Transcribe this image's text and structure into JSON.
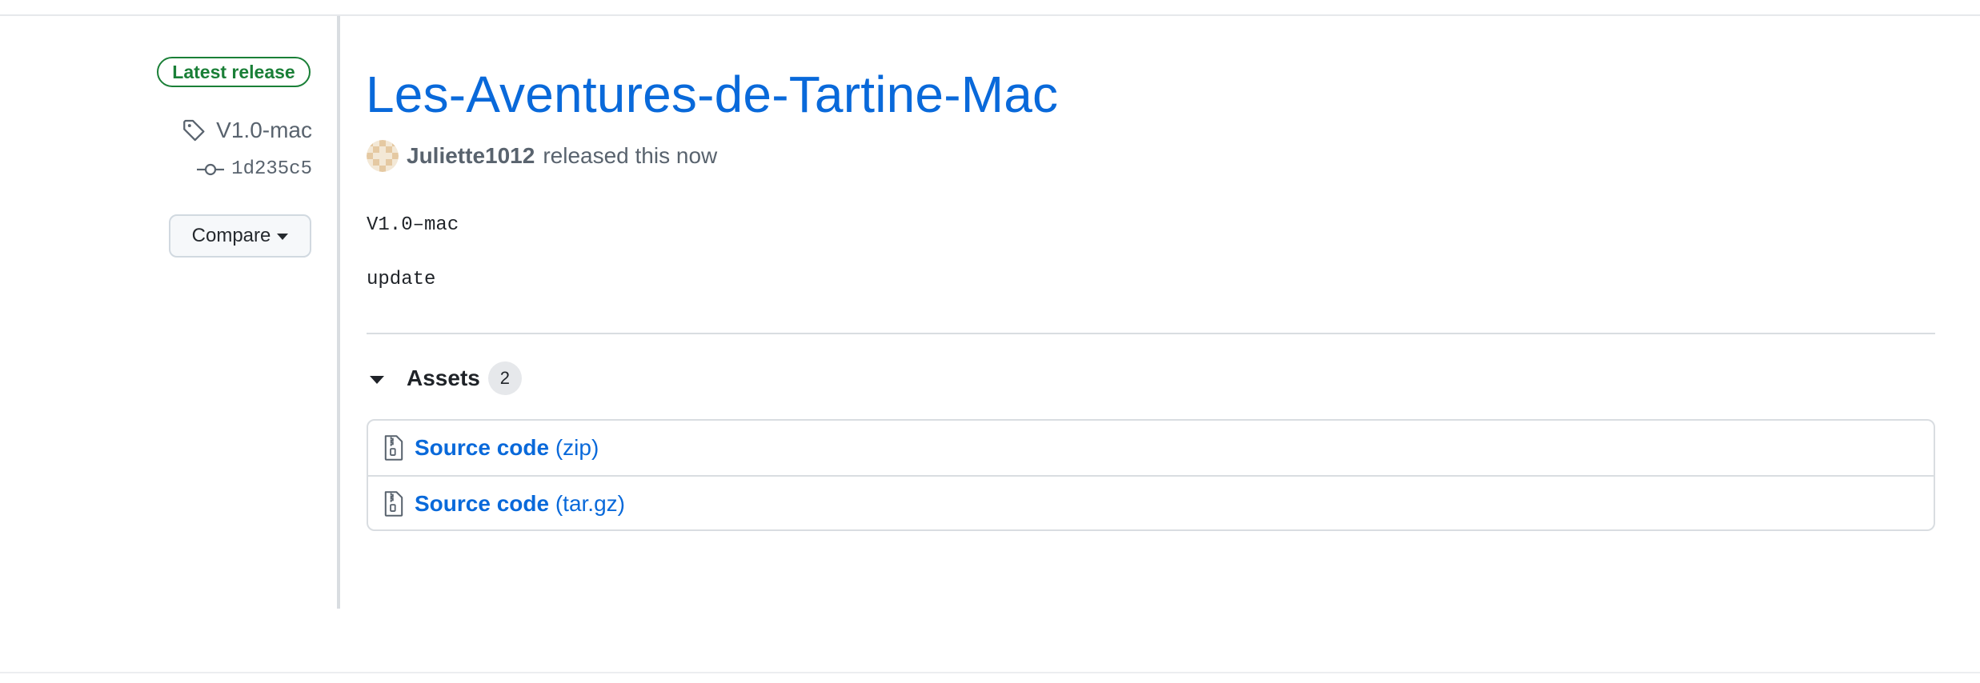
{
  "sidebar": {
    "badge": "Latest release",
    "tag": "V1.0-mac",
    "commit": "1d235c5",
    "compare_label": "Compare"
  },
  "release": {
    "title": "Les-Aventures-de-Tartine-Mac",
    "author": "Juliette1012",
    "released_text": "released this now",
    "body_lines": [
      "V1.0–mac",
      "update"
    ]
  },
  "assets": {
    "title": "Assets",
    "count": "2",
    "items": [
      {
        "name": "Source code",
        "format": "(zip)",
        "icon": "file-zip-icon"
      },
      {
        "name": "Source code",
        "format": "(tar.gz)",
        "icon": "file-zip-icon"
      }
    ]
  },
  "colors": {
    "link": "#0969da",
    "success": "#1a7f37",
    "muted_text": "#59636e",
    "border": "#d9dde1"
  }
}
